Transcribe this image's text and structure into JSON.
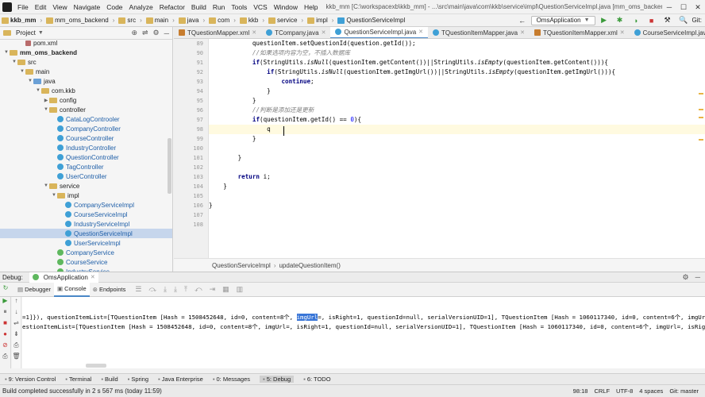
{
  "menubar": {
    "items": [
      "File",
      "Edit",
      "View",
      "Navigate",
      "Code",
      "Analyze",
      "Refactor",
      "Build",
      "Run",
      "Tools",
      "VCS",
      "Window",
      "Help"
    ],
    "window_title": "kkb_mm [C:\\workspacexb\\kkb_mm] - ...\\src\\main\\java\\com\\kkb\\service\\impl\\QuestionServiceImpl.java [mm_oms_backend]"
  },
  "navbar": {
    "crumbs": [
      "kkb_mm",
      "mm_oms_backend",
      "src",
      "main",
      "java",
      "com",
      "kkb",
      "service",
      "impl",
      "QuestionServiceImpl"
    ],
    "run_config": "OmsApplication",
    "git_label": "Git:"
  },
  "project": {
    "title": "Project",
    "tree": [
      {
        "label": "pom.xml",
        "indent": 3,
        "kind": "file"
      },
      {
        "label": "mm_oms_backend",
        "indent": 1,
        "kind": "folder",
        "open": true,
        "bold": true
      },
      {
        "label": "src",
        "indent": 2,
        "kind": "folder",
        "open": true
      },
      {
        "label": "main",
        "indent": 3,
        "kind": "folder",
        "open": true
      },
      {
        "label": "java",
        "indent": 4,
        "kind": "folder-blue",
        "open": true
      },
      {
        "label": "com.kkb",
        "indent": 5,
        "kind": "folder",
        "open": true
      },
      {
        "label": "config",
        "indent": 6,
        "kind": "folder",
        "open": false
      },
      {
        "label": "controller",
        "indent": 6,
        "kind": "folder",
        "open": true
      },
      {
        "label": "CataLogControoler",
        "indent": 7,
        "kind": "class"
      },
      {
        "label": "CompanyController",
        "indent": 7,
        "kind": "class"
      },
      {
        "label": "CourseController",
        "indent": 7,
        "kind": "class"
      },
      {
        "label": "IndustryController",
        "indent": 7,
        "kind": "class"
      },
      {
        "label": "QuestionController",
        "indent": 7,
        "kind": "class"
      },
      {
        "label": "TagController",
        "indent": 7,
        "kind": "class"
      },
      {
        "label": "UserController",
        "indent": 7,
        "kind": "class"
      },
      {
        "label": "service",
        "indent": 6,
        "kind": "folder",
        "open": true
      },
      {
        "label": "impl",
        "indent": 7,
        "kind": "folder",
        "open": true
      },
      {
        "label": "CompanyServiceImpl",
        "indent": 8,
        "kind": "class"
      },
      {
        "label": "CourseServiceImpl",
        "indent": 8,
        "kind": "class"
      },
      {
        "label": "IndustryServiceImpl",
        "indent": 8,
        "kind": "class"
      },
      {
        "label": "QuestionServiceImpl",
        "indent": 8,
        "kind": "class",
        "selected": true
      },
      {
        "label": "UserServiceImpl",
        "indent": 8,
        "kind": "class"
      },
      {
        "label": "CompanyService",
        "indent": 7,
        "kind": "interface"
      },
      {
        "label": "CourseService",
        "indent": 7,
        "kind": "interface"
      },
      {
        "label": "IndustryService",
        "indent": 7,
        "kind": "interface"
      }
    ]
  },
  "tabs": [
    {
      "label": "TQuestionMapper.xml",
      "icon": "xml",
      "active": false
    },
    {
      "label": "TCompany.java",
      "icon": "class",
      "active": false
    },
    {
      "label": "QuestionServiceImpl.java",
      "icon": "class",
      "active": true
    },
    {
      "label": "TQuestionItemMapper.java",
      "icon": "class",
      "active": false
    },
    {
      "label": "TQuestionItemMapper.xml",
      "icon": "xml",
      "active": false
    },
    {
      "label": "CourseServiceImpl.java",
      "icon": "class",
      "active": false
    }
  ],
  "editor": {
    "lines": [
      {
        "n": "89",
        "html": "            questionItem.setQuestionId(question.getId());"
      },
      {
        "n": "90",
        "html": "            <span class='cm'>//如果选项内容为空，不插入数据库</span>"
      },
      {
        "n": "91",
        "html": "            <span class='kw'>if</span>(StringUtils.<span class='it'>isNull</span>(questionItem.getContent())||StringUtils.<span class='it'>isEmpty</span>(questionItem.getContent())){"
      },
      {
        "n": "92",
        "html": "                <span class='kw'>if</span>(StringUtils.<span class='it'>isNull</span>(questionItem.getImgUrl())||StringUtils.<span class='it'>isEmpty</span>(questionItem.getImgUrl())){"
      },
      {
        "n": "93",
        "html": "                    <span class='kw'>continue</span>;"
      },
      {
        "n": "94",
        "html": "                }"
      },
      {
        "n": "95",
        "html": "            }"
      },
      {
        "n": "96",
        "html": "            <span class='cm'>//判断是添加还是更新</span>"
      },
      {
        "n": "97",
        "html": "            <span class='kw'>if</span>(questionItem.getId() == <span class='num'>0</span>){"
      },
      {
        "n": "98",
        "html": "                q|",
        "hl": true
      },
      {
        "n": "99",
        "html": "            }"
      },
      {
        "n": "100",
        "html": ""
      },
      {
        "n": "101",
        "html": "        }"
      },
      {
        "n": "102",
        "html": ""
      },
      {
        "n": "103",
        "html": "        <span class='kw'>return</span> i;"
      },
      {
        "n": "104",
        "html": "    }"
      },
      {
        "n": "105",
        "html": ""
      },
      {
        "n": "106",
        "html": "}"
      },
      {
        "n": "107",
        "html": ""
      },
      {
        "n": "108",
        "html": ""
      }
    ],
    "breadcrumb": [
      "QuestionServiceImpl",
      "updateQuestionItem()"
    ]
  },
  "debug": {
    "title": "Debug:",
    "session": "OmsApplication",
    "tabs": [
      "Debugger",
      "Console",
      "Endpoints"
    ],
    "console_lines": [
      {
        "pre": "=1]}), questionItemList=[TQuestionItem [Hash = 1508452648, id=0, content=8个, ",
        "sel": "imgUrl",
        "post": "=, isRight=1, questionId=null, serialVersionUID=1], TQuestionItem [Hash = 1060117340, id=0, content=6个, imgUrl=, isRig"
      },
      {
        "pre": "estionItemList=[TQuestionItem [Hash = 1508452648, id=0, content=8个, imgUrl=, isRight=1, questionId=null, serialVersionUID=1], TQuestionItem [Hash = 1060117340, id=0, content=6个, imgUrl=, isRight=",
        "sel": "",
        "post": ""
      }
    ]
  },
  "bottom_tools": [
    {
      "label": "9: Version Control",
      "active": false
    },
    {
      "label": "Terminal",
      "active": false
    },
    {
      "label": "Build",
      "active": false
    },
    {
      "label": "Spring",
      "active": false
    },
    {
      "label": "Java Enterprise",
      "active": false
    },
    {
      "label": "0: Messages",
      "active": false
    },
    {
      "label": "5: Debug",
      "active": true
    },
    {
      "label": "6: TODO",
      "active": false
    }
  ],
  "status": {
    "message": "Build completed successfully in 2 s 567 ms (today 11:59)",
    "position": "98:18",
    "line_sep": "CRLF",
    "encoding": "UTF-8",
    "indent": "4 spaces",
    "vcs": "Git: master"
  },
  "colors": {
    "accent": "#4a88c7",
    "selection": "#3875d7",
    "keyword": "#000080"
  }
}
